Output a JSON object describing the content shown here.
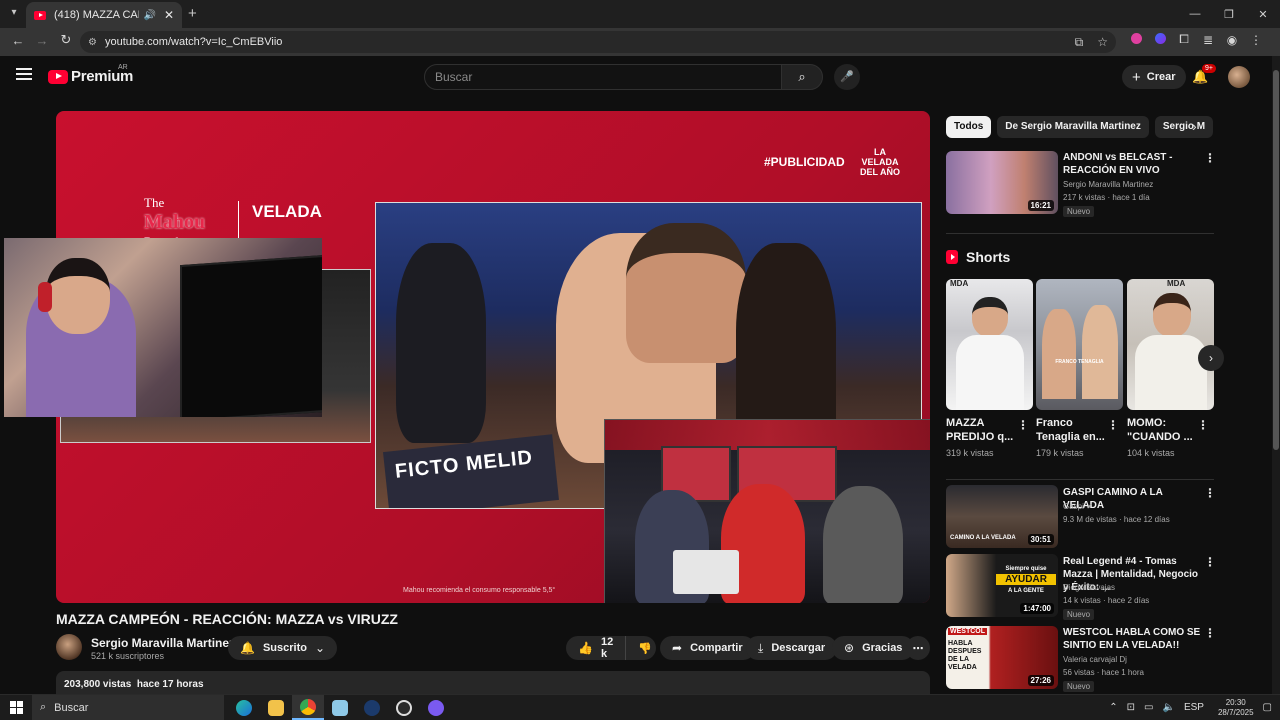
{
  "browser": {
    "tab_title": "(418) MAZZA CAMPEÓN - R",
    "url": "youtube.com/watch?v=Ic_CmEBViio"
  },
  "masthead": {
    "logo_text": "Premium",
    "country_code": "AR",
    "search_placeholder": "Buscar",
    "create_label": "Crear",
    "notif_badge": "9+"
  },
  "player": {
    "ad_tag": "#PUBLICIDAD",
    "velada_top": "LA VELADA DEL AÑO",
    "brand_the": "The",
    "brand_mahou": "Mahou",
    "brand_round": "Round",
    "brand_velada": "VELADA",
    "banner_text": "FICTO MELID",
    "disclaimer": "Mahou recomienda el consumo responsable 5,5°"
  },
  "video": {
    "title": "MAZZA CAMPEÓN - REACCIÓN: MAZZA vs VIRUZZ",
    "channel": "Sergio Maravilla Martinez",
    "subscribers": "521 k suscriptores",
    "subscribed_label": "Suscrito",
    "likes": "12 k",
    "share_label": "Compartir",
    "download_label": "Descargar",
    "thanks_label": "Gracias",
    "views": "203,800 vistas",
    "age": "hace 17 horas"
  },
  "sidebar": {
    "chips": [
      "Todos",
      "De Sergio Maravilla Martinez",
      "Sergio M"
    ],
    "shorts_label": "Shorts",
    "videos": [
      {
        "title": "ANDONI vs BELCAST - REACCIÓN EN VIVO",
        "channel": "Sergio Maravilla Martinez",
        "meta": "217 k vistas · hace 1 día",
        "duration": "16:21",
        "badge": "Nuevo"
      },
      {
        "title": "GASPI CAMINO A LA VELADA",
        "channel": "Gaspi ✔",
        "meta": "9.3 M de vistas · hace 12 días",
        "duration": "30:51",
        "badge": ""
      },
      {
        "title": "Real Legend #4 - Tomas Mazza | Mentalidad, Negocio y Éxito: ...",
        "channel": "Diego Navajas",
        "meta": "14 k vistas · hace 2 días",
        "duration": "1:47:00",
        "badge": "Nuevo"
      },
      {
        "title": "WESTCOL HABLA COMO SE SINTIO EN LA VELADA!!",
        "channel": "Valeria carvajal Dj",
        "meta": "56 vistas · hace 1 hora",
        "duration": "27:26",
        "badge": "Nuevo"
      }
    ],
    "shorts": [
      {
        "title": "MAZZA PREDIJO q...",
        "views": "319 k vistas"
      },
      {
        "title": "Franco Tenaglia en...",
        "views": "179 k vistas"
      },
      {
        "title": "MOMO: \"CUANDO ...",
        "views": "104 k vistas"
      }
    ],
    "thumb_texts": {
      "ayudar_top": "Siempre quise",
      "ayudar_mid": "AYUDAR",
      "ayudar_bot": "A LA GENTE",
      "westcol_tag": "WESTCOL",
      "westcol_text": "HABLA DESPUES DE LA VELADA",
      "gaspi_text": "CAMINO A LA VELADA",
      "short_mark": "MDA",
      "short_caption": "FRANCO TENAGLIA"
    }
  },
  "taskbar": {
    "search_label": "Buscar",
    "lang": "ESP",
    "time": "20:30",
    "date": "28/7/2025"
  }
}
